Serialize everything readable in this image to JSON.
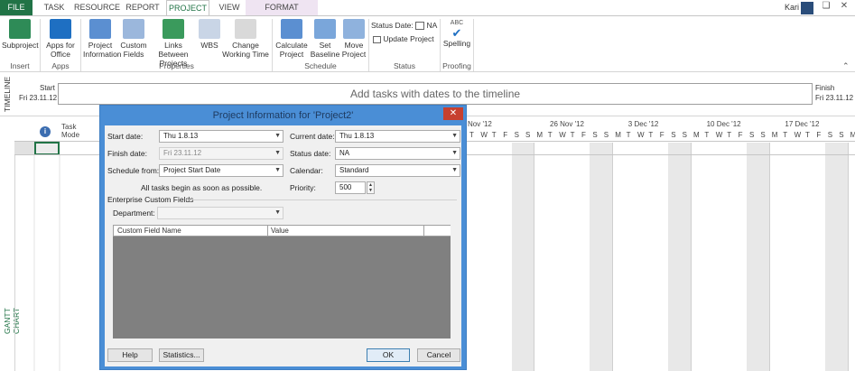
{
  "tabs": [
    "FILE",
    "TASK",
    "RESOURCE",
    "REPORT",
    "PROJECT",
    "VIEW",
    "FORMAT"
  ],
  "user": {
    "name": "Kari"
  },
  "ribbon": {
    "buttons": {
      "subproject": "Subproject",
      "apps_for_office": "Apps for Office",
      "project_information": "Project Information",
      "custom_fields": "Custom Fields",
      "links_between_projects": "Links Between Projects",
      "wbs": "WBS",
      "change_working_time": "Change Working Time",
      "calculate_project": "Calculate Project",
      "set_baseline": "Set Baseline",
      "move_project": "Move Project",
      "status_date_label": "Status Date:",
      "status_date_value": "NA",
      "update_project": "Update Project",
      "spelling": "Spelling",
      "spelling_icon_text": "ABC"
    },
    "groups": [
      "Insert",
      "Apps",
      "Properties",
      "Schedule",
      "Status",
      "Proofing"
    ]
  },
  "timeline": {
    "side_label": "TIMELINE",
    "start_label": "Start",
    "start_date": "Fri 23.11.12",
    "finish_label": "Finish",
    "finish_date": "Fri 23.11.12",
    "placeholder": "Add tasks with dates to the timeline"
  },
  "gantt": {
    "side_label": "GANTT CHART",
    "col_task_mode": "Task Mode",
    "weeks": [
      "Nov '12",
      "26 Nov '12",
      "3 Dec '12",
      "10 Dec '12",
      "17 Dec '12"
    ],
    "day_letters": [
      "T",
      "W",
      "T",
      "F",
      "S",
      "S",
      "M",
      "T",
      "W",
      "T",
      "F",
      "S",
      "S",
      "M",
      "T",
      "W",
      "T",
      "F",
      "S",
      "S",
      "M",
      "T",
      "W",
      "T",
      "F",
      "S",
      "S",
      "M",
      "T",
      "W",
      "T",
      "F",
      "S",
      "S",
      "M",
      "T",
      "W"
    ]
  },
  "dialog": {
    "title": "Project Information for 'Project2'",
    "start_date_label": "Start date:",
    "start_date_value": "Thu 1.8.13",
    "finish_date_label": "Finish date:",
    "finish_date_value": "Fri 23.11.12",
    "schedule_from_label": "Schedule from:",
    "schedule_from_value": "Project Start Date",
    "schedule_note": "All tasks begin as soon as possible.",
    "current_date_label": "Current date:",
    "current_date_value": "Thu 1.8.13",
    "status_date_label": "Status date:",
    "status_date_value": "NA",
    "calendar_label": "Calendar:",
    "calendar_value": "Standard",
    "priority_label": "Priority:",
    "priority_value": "500",
    "enterprise_label": "Enterprise Custom Fields",
    "department_label": "Department:",
    "table_headers": [
      "Custom Field Name",
      "Value"
    ],
    "buttons": {
      "help": "Help",
      "statistics": "Statistics...",
      "ok": "OK",
      "cancel": "Cancel"
    }
  },
  "colors": {
    "accent": "#217346",
    "dialog_frame": "#4a8ed6",
    "weekend_shade": "#e8e8e8",
    "table_gray": "#808080"
  }
}
